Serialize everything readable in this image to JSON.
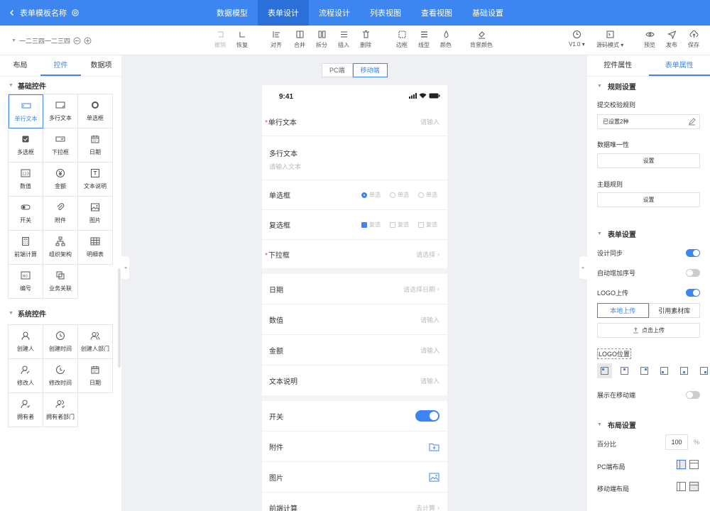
{
  "header": {
    "back_title": "表单模板名称",
    "tabs": [
      {
        "label": "数据模型"
      },
      {
        "label": "表单设计"
      },
      {
        "label": "流程设计"
      },
      {
        "label": "列表视图"
      },
      {
        "label": "查看视图"
      },
      {
        "label": "基础设置"
      }
    ]
  },
  "toolbar": {
    "table_name": "一二三四一二三四",
    "undo": "撤销",
    "redo": "恢复",
    "align": "对齐",
    "merge": "合并",
    "split": "拆分",
    "insert": "插入",
    "delete": "删除",
    "border": "边框",
    "line": "线型",
    "color": "颜色",
    "bgcolor": "背景颜色",
    "version": "V1.0",
    "source_mode": "源码模式",
    "preview": "预览",
    "publish": "发布",
    "save": "保存"
  },
  "left_panel": {
    "tabs": [
      {
        "label": "布局"
      },
      {
        "label": "控件"
      },
      {
        "label": "数据项"
      }
    ],
    "basic_title": "基础控件",
    "basic_items": [
      {
        "label": "单行文本",
        "icon": "single-line-text-icon"
      },
      {
        "label": "多行文本",
        "icon": "multi-line-text-icon"
      },
      {
        "label": "单选框",
        "icon": "radio-icon"
      },
      {
        "label": "多选框",
        "icon": "checkbox-icon"
      },
      {
        "label": "下拉框",
        "icon": "dropdown-icon"
      },
      {
        "label": "日期",
        "icon": "calendar-icon"
      },
      {
        "label": "数值",
        "icon": "number-icon"
      },
      {
        "label": "金额",
        "icon": "money-icon"
      },
      {
        "label": "文本说明",
        "icon": "text-description-icon"
      },
      {
        "label": "开关",
        "icon": "switch-icon"
      },
      {
        "label": "附件",
        "icon": "attachment-icon"
      },
      {
        "label": "图片",
        "icon": "image-icon"
      },
      {
        "label": "前端计算",
        "icon": "calculator-icon"
      },
      {
        "label": "组织架构",
        "icon": "org-chart-icon"
      },
      {
        "label": "明细表",
        "icon": "table-icon"
      },
      {
        "label": "编号",
        "icon": "serial-number-icon"
      },
      {
        "label": "业务关联",
        "icon": "relation-icon"
      }
    ],
    "system_title": "系统控件",
    "system_items": [
      {
        "label": "创建人",
        "icon": "user-icon"
      },
      {
        "label": "创建时间",
        "icon": "clock-icon"
      },
      {
        "label": "创建人部门",
        "icon": "users-icon"
      },
      {
        "label": "修改人",
        "icon": "user-edit-icon"
      },
      {
        "label": "修改时间",
        "icon": "clock-edit-icon"
      },
      {
        "label": "日期",
        "icon": "calendar-icon"
      },
      {
        "label": "拥有者",
        "icon": "user-owner-icon"
      },
      {
        "label": "拥有者部门",
        "icon": "users-owner-icon"
      }
    ]
  },
  "canvas": {
    "pc_label": "PC端",
    "mobile_label": "移动端",
    "time": "9:41",
    "fields": {
      "single_text": {
        "label": "单行文本",
        "placeholder": "请输入"
      },
      "multi_text": {
        "label": "多行文本",
        "placeholder": "请输入文本"
      },
      "radio": {
        "label": "单选框",
        "option": "单选"
      },
      "checkbox": {
        "label": "复选框",
        "option": "复选"
      },
      "dropdown": {
        "label": "下拉框",
        "placeholder": "请选择"
      },
      "date": {
        "label": "日期",
        "placeholder": "请选择日期"
      },
      "number": {
        "label": "数值",
        "placeholder": "请输入"
      },
      "amount": {
        "label": "金额",
        "placeholder": "请输入"
      },
      "text_desc": {
        "label": "文本说明",
        "placeholder": "请输入"
      },
      "switch": {
        "label": "开关"
      },
      "attachment": {
        "label": "附件"
      },
      "image": {
        "label": "图片"
      },
      "calc": {
        "label": "前端计算",
        "placeholder": "去计算"
      }
    }
  },
  "right_panel": {
    "tabs": [
      {
        "label": "控件属性"
      },
      {
        "label": "表单属性"
      }
    ],
    "rules_title": "规则设置",
    "submit_rule_label": "提交校验规则",
    "submit_rule_value": "已设置2种",
    "unique_label": "数据唯一性",
    "set_label": "设置",
    "theme_label": "主题规则",
    "form_title": "表单设置",
    "design_sync": "设计同步",
    "auto_seq": "自动增加序号",
    "logo_upload": "LOGO上传",
    "local_upload": "本地上传",
    "material": "引用素材库",
    "click_upload": "点击上传",
    "logo_pos": "LOGO位置",
    "show_mobile": "展示在移动端",
    "layout_title": "布局设置",
    "percent_label": "百分比",
    "percent_value": "100",
    "percent_unit": "%",
    "pc_layout": "PC端布局",
    "mobile_layout": "移动端布局"
  },
  "colors": {
    "accent": "#3d86f1",
    "required": "#e34d4d"
  }
}
